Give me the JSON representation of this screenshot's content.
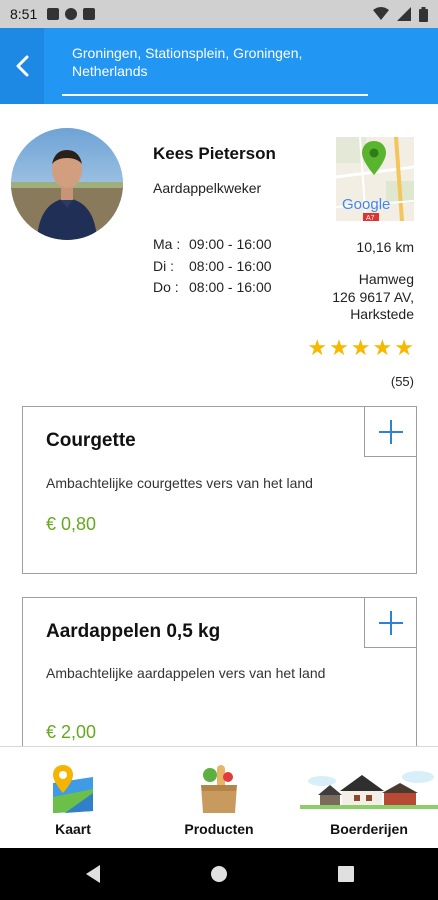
{
  "status_bar": {
    "time": "8:51"
  },
  "header": {
    "location": "Groningen, Stationsplein, Groningen, Netherlands"
  },
  "farmer": {
    "name": "Kees Pieterson",
    "role": "Aardappelkweker",
    "hours": [
      {
        "day": "Ma :",
        "time": "09:00 - 16:00"
      },
      {
        "day": "Di :",
        "time": "08:00 - 16:00"
      },
      {
        "day": "Do :",
        "time": "08:00 - 16:00"
      }
    ],
    "map_brand": "Google",
    "map_road": "A7",
    "distance": "10,16 km",
    "address": [
      "Hamweg",
      "126 9617 AV,",
      "Harkstede"
    ],
    "rating": 5,
    "stars": [
      "★",
      "★",
      "★",
      "★",
      "★"
    ],
    "review_count": "(55)"
  },
  "products": [
    {
      "title": "Courgette",
      "description": "Ambachtelijke courgettes vers van het land",
      "price": "€ 0,80"
    },
    {
      "title": "Aardappelen 0,5 kg",
      "description": "Ambachtelijke aardappelen vers van het land",
      "price": "€ 2,00"
    }
  ],
  "bottom_nav": {
    "items": [
      {
        "label": "Kaart",
        "icon": "map-pin-icon"
      },
      {
        "label": "Producten",
        "icon": "grocery-bag-icon"
      },
      {
        "label": "Boerderijen",
        "icon": "farm-icon"
      }
    ]
  },
  "colors": {
    "primary": "#2196f3",
    "price": "#66a81e",
    "star": "#f7b900"
  }
}
